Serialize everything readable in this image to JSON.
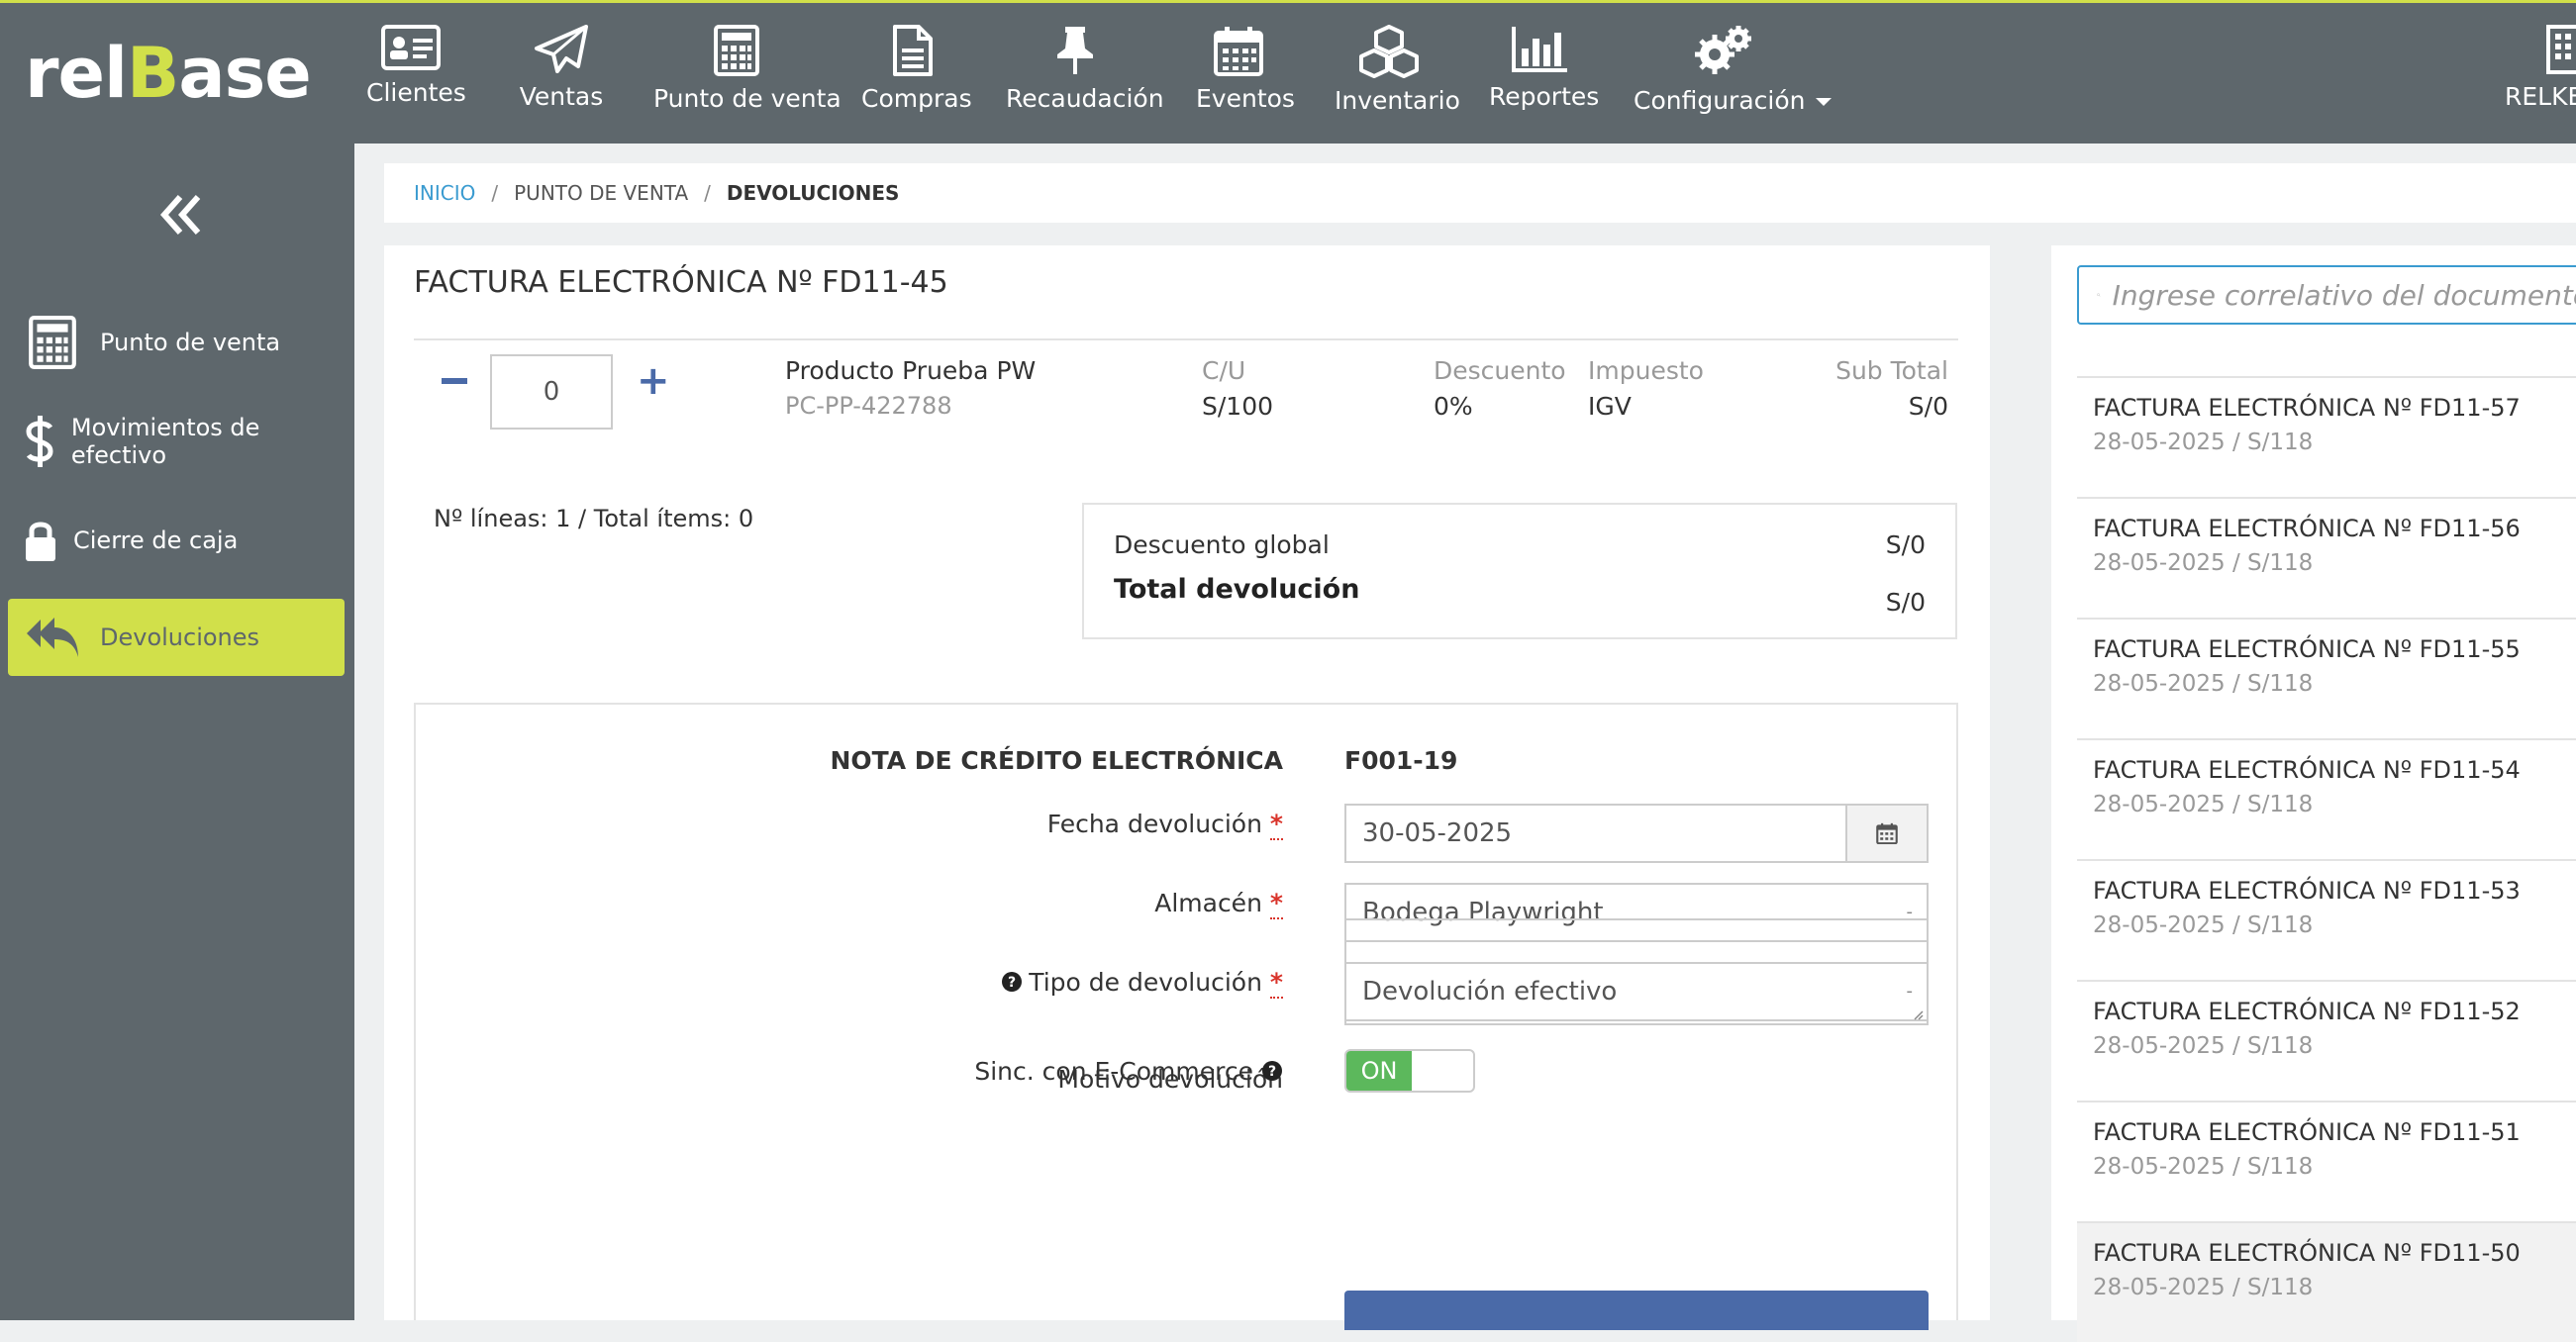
{
  "app": {
    "logo_pre": "rel",
    "logo_b": "B",
    "logo_post": "ase",
    "accent_color": "#d1e04a",
    "header_color": "#5e676c"
  },
  "nav": {
    "items": [
      {
        "label": "Clientes",
        "icon": "id-card-icon"
      },
      {
        "label": "Ventas",
        "icon": "paper-plane-icon"
      },
      {
        "label": "Punto de venta",
        "icon": "calculator-icon"
      },
      {
        "label": "Compras",
        "icon": "file-icon"
      },
      {
        "label": "Recaudación",
        "icon": "pushpin-icon"
      },
      {
        "label": "Eventos",
        "icon": "calendar-icon"
      },
      {
        "label": "Inventario",
        "icon": "cubes-icon"
      },
      {
        "label": "Reportes",
        "icon": "bar-chart-icon"
      },
      {
        "label": "Configuración",
        "icon": "gears-icon"
      }
    ],
    "company": "RELKE"
  },
  "sidebar": {
    "items": [
      {
        "label": "Punto de venta",
        "icon": "calculator-icon"
      },
      {
        "label": "Movimientos de efectivo",
        "icon": "dollar-icon"
      },
      {
        "label": "Cierre de caja",
        "icon": "lock-icon"
      },
      {
        "label": "Devoluciones",
        "icon": "reply-all-icon",
        "active": true
      }
    ]
  },
  "breadcrumb": {
    "home": "INICIO",
    "sep": "/",
    "section": "PUNTO DE VENTA",
    "current": "DEVOLUCIONES"
  },
  "invoice": {
    "title": "FACTURA ELECTRÓNICA Nº FD11-45",
    "qty": "0",
    "product_name": "Producto Prueba PW",
    "product_code": "PC-PP-422788",
    "cu_label": "C/U",
    "cu_value": "S/100",
    "discount_label": "Descuento",
    "discount_value": "0%",
    "tax_label": "Impuesto",
    "tax_value": "IGV",
    "subtotal_label": "Sub Total",
    "subtotal_value": "S/0",
    "lines_text": "Nº líneas: 1 / Total ítems: 0",
    "global_discount_label": "Descuento global",
    "global_discount_value": "S/0",
    "total_label": "Total devolución",
    "total_value": "S/0"
  },
  "form": {
    "doc_type": "NOTA DE CRÉDITO ELECTRÓNICA",
    "doc_number": "F001-19",
    "required_mark": "*",
    "date_label": "Fecha devolución",
    "date_value": "30-05-2025",
    "warehouse_label": "Almacén",
    "warehouse_value": "Bodega Playwright",
    "type_label": "Tipo de devolución",
    "type_value": "Devolución efectivo",
    "reason_label": "Motivo devolución",
    "sync_label": "Sinc. con E-Commerce",
    "sync_value": "ON",
    "select_dash": "-"
  },
  "search": {
    "placeholder": "Ingrese correlativo del documento"
  },
  "documents": [
    {
      "title": "FACTURA ELECTRÓNICA Nº FD11-57",
      "sub": "28-05-2025 / S/118"
    },
    {
      "title": "FACTURA ELECTRÓNICA Nº FD11-56",
      "sub": "28-05-2025 / S/118"
    },
    {
      "title": "FACTURA ELECTRÓNICA Nº FD11-55",
      "sub": "28-05-2025 / S/118"
    },
    {
      "title": "FACTURA ELECTRÓNICA Nº FD11-54",
      "sub": "28-05-2025 / S/118"
    },
    {
      "title": "FACTURA ELECTRÓNICA Nº FD11-53",
      "sub": "28-05-2025 / S/118"
    },
    {
      "title": "FACTURA ELECTRÓNICA Nº FD11-52",
      "sub": "28-05-2025 / S/118"
    },
    {
      "title": "FACTURA ELECTRÓNICA Nº FD11-51",
      "sub": "28-05-2025 / S/118"
    },
    {
      "title": "FACTURA ELECTRÓNICA Nº FD11-50",
      "sub": "28-05-2025 / S/118"
    }
  ]
}
